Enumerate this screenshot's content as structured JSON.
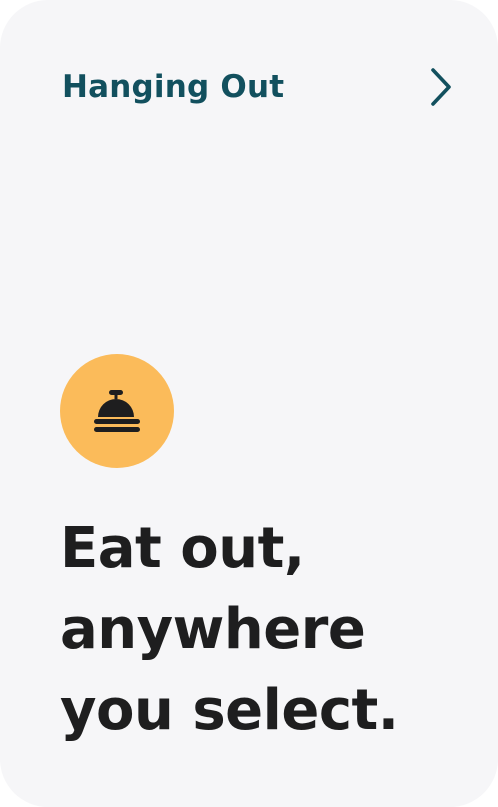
{
  "header": {
    "title": "Hanging Out",
    "next_icon": "chevron-right-icon"
  },
  "feature": {
    "icon": "cloche-icon",
    "accent_color": "#fbbb5a",
    "headline_lines": [
      "Eat out,",
      "anywhere",
      "you select."
    ]
  },
  "colors": {
    "background": "#f6f6f8",
    "title": "#12505e",
    "text": "#1e1e1f"
  }
}
